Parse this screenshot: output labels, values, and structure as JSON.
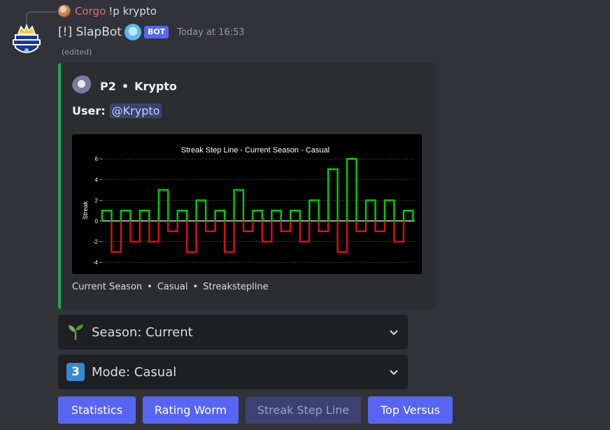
{
  "reply": {
    "username": "Corgo",
    "content": "!p krypto"
  },
  "message": {
    "bot_name": "[!] SlapBot",
    "bot_badge": "BOT",
    "timestamp": "Today at 16:53",
    "edited": "(edited)"
  },
  "embed": {
    "accent_color": "#23a559",
    "author_prefix": "P2",
    "author_separator": "•",
    "author_name": "Krypto",
    "user_label": "User:",
    "user_mention": "@Krypto",
    "footer": {
      "season": "Current Season",
      "mode": "Casual",
      "chart": "Streakstepline",
      "separator": "•"
    }
  },
  "chart_data": {
    "type": "line",
    "subtype": "step",
    "title": "Streak Step Line - Current Season - Casual",
    "xlabel": "",
    "ylabel": "Streak",
    "ylim": [
      -5,
      7
    ],
    "yticks": [
      6,
      4,
      2,
      0,
      -2,
      -4
    ],
    "grid": true,
    "zero_line": true,
    "positive_color": "#00d000",
    "negative_color": "#e01010",
    "values": [
      1,
      -3,
      1,
      -2,
      1,
      -2,
      3,
      -1,
      1,
      -3,
      2,
      -1,
      1,
      -3,
      3,
      -1,
      1,
      -2,
      1,
      -1,
      1,
      -2,
      2,
      -1,
      5,
      -3,
      6,
      -1,
      2,
      -1,
      2,
      -2,
      1
    ]
  },
  "selects": {
    "season": {
      "emoji": "seedling-icon",
      "label": "Season: Current"
    },
    "mode": {
      "emoji_text": "3",
      "label": "Mode: Casual"
    }
  },
  "buttons": [
    {
      "label": "Statistics",
      "disabled": false
    },
    {
      "label": "Rating Worm",
      "disabled": false
    },
    {
      "label": "Streak Step Line",
      "disabled": true
    },
    {
      "label": "Top Versus",
      "disabled": false
    }
  ]
}
